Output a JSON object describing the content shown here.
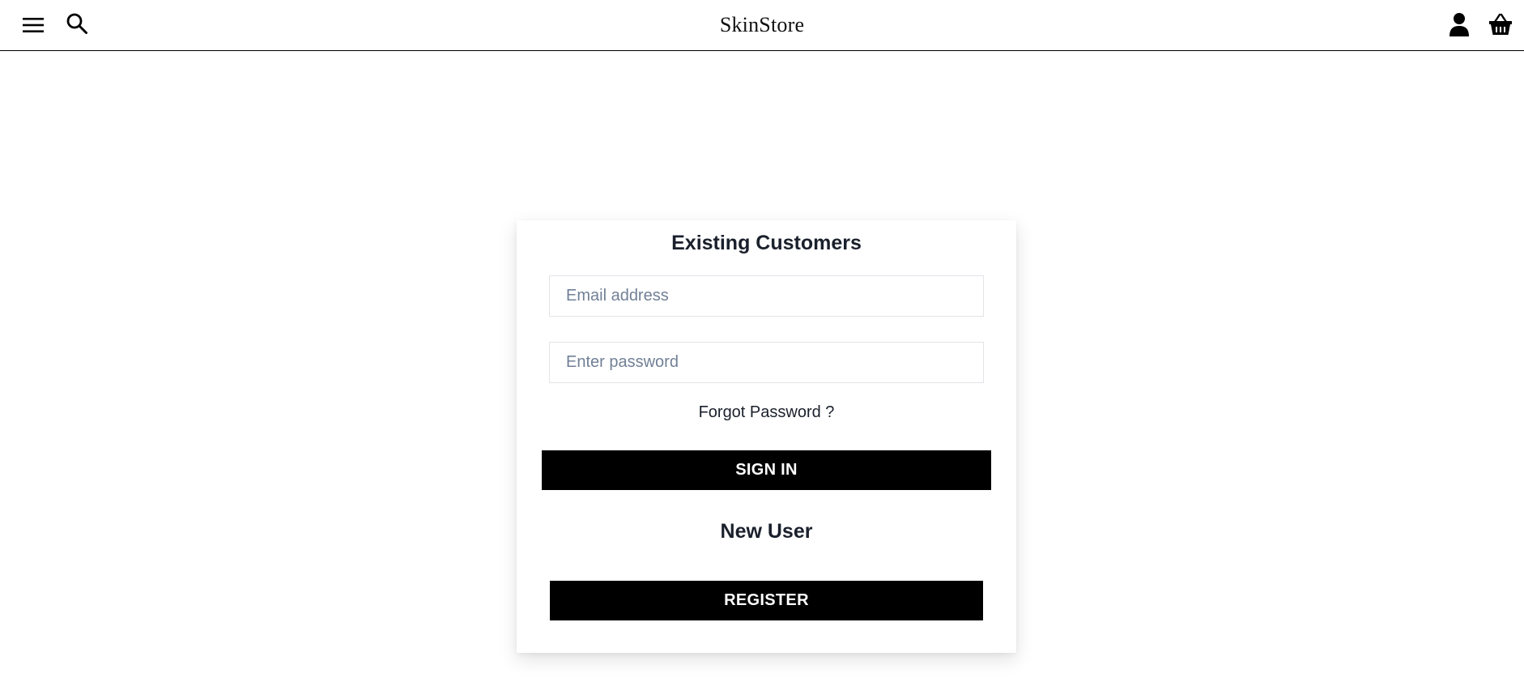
{
  "header": {
    "logo": "SkinStore",
    "icons": {
      "menu": "hamburger-menu-icon",
      "search": "search-icon",
      "account": "user-icon",
      "cart": "shopping-basket-icon"
    }
  },
  "login": {
    "title": "Existing Customers",
    "email_placeholder": "Email address",
    "email_value": "",
    "password_placeholder": "Enter password",
    "password_value": "",
    "forgot_label": "Forgot Password ?",
    "signin_label": "SIGN IN"
  },
  "register": {
    "title": "New User",
    "register_label": "REGISTER"
  },
  "colors": {
    "button_bg": "#000000",
    "button_text": "#ffffff",
    "heading_text": "#1a202c",
    "placeholder_text": "#718096",
    "input_border": "#e2e4e8"
  }
}
